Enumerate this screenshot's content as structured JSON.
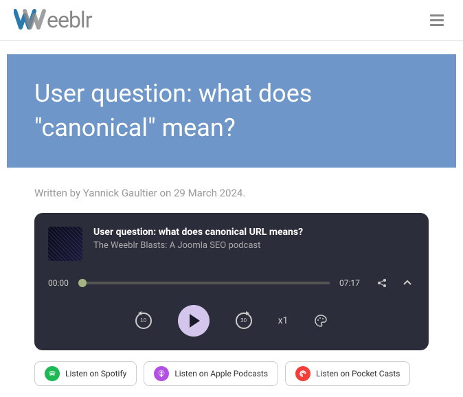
{
  "brand": {
    "name": "Weeblr"
  },
  "hero": {
    "title": "User question: what does \"canonical\" mean?"
  },
  "byline": {
    "text": "Written by Yannick Gaultier on 29 March 2024."
  },
  "player": {
    "title": "User question: what does canonical URL means?",
    "subtitle": "The Weeblr Blasts: A Joomla SEO podcast",
    "current": "00:00",
    "duration": "07:17",
    "speed": "x1",
    "skipBack": "10",
    "skipForward": "30"
  },
  "listen": {
    "spotify": "Listen on Spotify",
    "apple": "Listen on Apple Podcasts",
    "pocket": "Listen on Pocket Casts"
  }
}
